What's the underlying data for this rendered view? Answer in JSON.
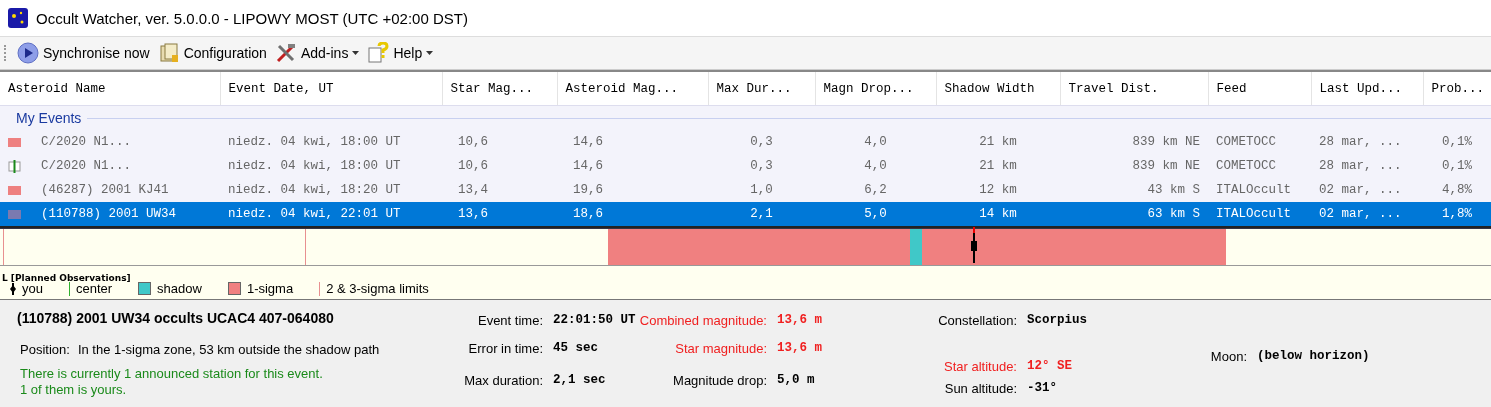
{
  "window": {
    "title": "Occult Watcher, ver. 5.0.0.0 - LIPOWY MOST (UTC +02:00 DST)"
  },
  "toolbar": [
    {
      "label": "Synchronise now",
      "kind": "sync",
      "dropdown": false
    },
    {
      "label": "Configuration",
      "kind": "config",
      "dropdown": false
    },
    {
      "label": "Add-ins",
      "kind": "tools",
      "dropdown": true
    },
    {
      "label": "Help",
      "kind": "help",
      "dropdown": true
    }
  ],
  "table": {
    "columns": [
      "Asteroid Name",
      "Event Date, UT",
      "Star Mag...",
      "Asteroid Mag...",
      "Max Dur...",
      "Magn Drop...",
      "Shadow Width",
      "Travel Dist.",
      "Feed",
      "Last Upd...",
      "Prob..."
    ],
    "group": "My Events",
    "rows": [
      {
        "kind": "sigma",
        "cells": [
          "C/2020 N1...",
          "niedz. 04 kwi, 18:00 UT",
          "10,6",
          "14,6",
          "0,3",
          "4,0",
          "21 km",
          "839 km NE",
          "COMETOCC",
          "28 mar, ...",
          "0,1%"
        ],
        "selected": false
      },
      {
        "kind": "station",
        "cells": [
          "C/2020 N1...",
          "niedz. 04 kwi, 18:00 UT",
          "10,6",
          "14,6",
          "0,3",
          "4,0",
          "21 km",
          "839 km NE",
          "COMETOCC",
          "28 mar, ...",
          "0,1%"
        ],
        "selected": false
      },
      {
        "kind": "sigma",
        "cells": [
          "(46287) 2001 KJ41",
          "niedz. 04 kwi, 18:20 UT",
          "13,4",
          "19,6",
          "1,0",
          "6,2",
          "12 km",
          "43 km S",
          "ITALOccult",
          "02 mar, ...",
          "4,8%"
        ],
        "selected": false
      },
      {
        "kind": "sigma",
        "cells": [
          "(110788) 2001 UW34",
          "niedz. 04 kwi, 22:01 UT",
          "13,6",
          "18,6",
          "2,1",
          "5,0",
          "14 km",
          "63 km S",
          "ITALOccult",
          "02 mar, ...",
          "1,8%"
        ],
        "selected": true
      }
    ]
  },
  "timeline": {
    "label": "L [Planned Observations]",
    "legend": [
      {
        "kind": "you",
        "label": "you"
      },
      {
        "kind": "center",
        "label": "center"
      },
      {
        "kind": "shadow",
        "label": "shadow"
      },
      {
        "kind": "sigma",
        "label": "1-sigma"
      },
      {
        "kind": "limits",
        "label": "2 & 3-sigma limits"
      }
    ]
  },
  "details": {
    "title": "(110788) 2001 UW34 occults UCAC4 407-064080",
    "position_label": "Position:",
    "position": "In the 1-sigma zone, 53 km outside the shadow path",
    "stations": [
      "There is currently 1 announced station for this event.",
      "1 of them is yours."
    ],
    "columns": [
      [
        {
          "label": "Event time:",
          "value": "22:01:50 UT",
          "alert": false
        },
        {
          "label": "Error in time:",
          "value": "45 sec",
          "alert": false
        },
        {
          "label": "Max duration:",
          "value": "2,1 sec",
          "alert": false
        }
      ],
      [
        {
          "label": "Combined magnitude:",
          "value": "13,6 m",
          "alert": true
        },
        {
          "label": "Star magnitude:",
          "value": "13,6 m",
          "alert": true
        },
        {
          "label": "Magnitude drop:",
          "value": "5,0 m",
          "alert": false
        }
      ],
      [
        {
          "label": "Constellation:",
          "value": "Scorpius",
          "alert": false
        },
        {
          "label": "Star altitude:",
          "value": "12° SE",
          "alert": true
        },
        {
          "label": "Sun altitude:",
          "value": "-31°",
          "alert": false
        }
      ],
      [
        {
          "label": "Moon:",
          "value": "(below horizon)",
          "alert": false
        }
      ]
    ]
  }
}
